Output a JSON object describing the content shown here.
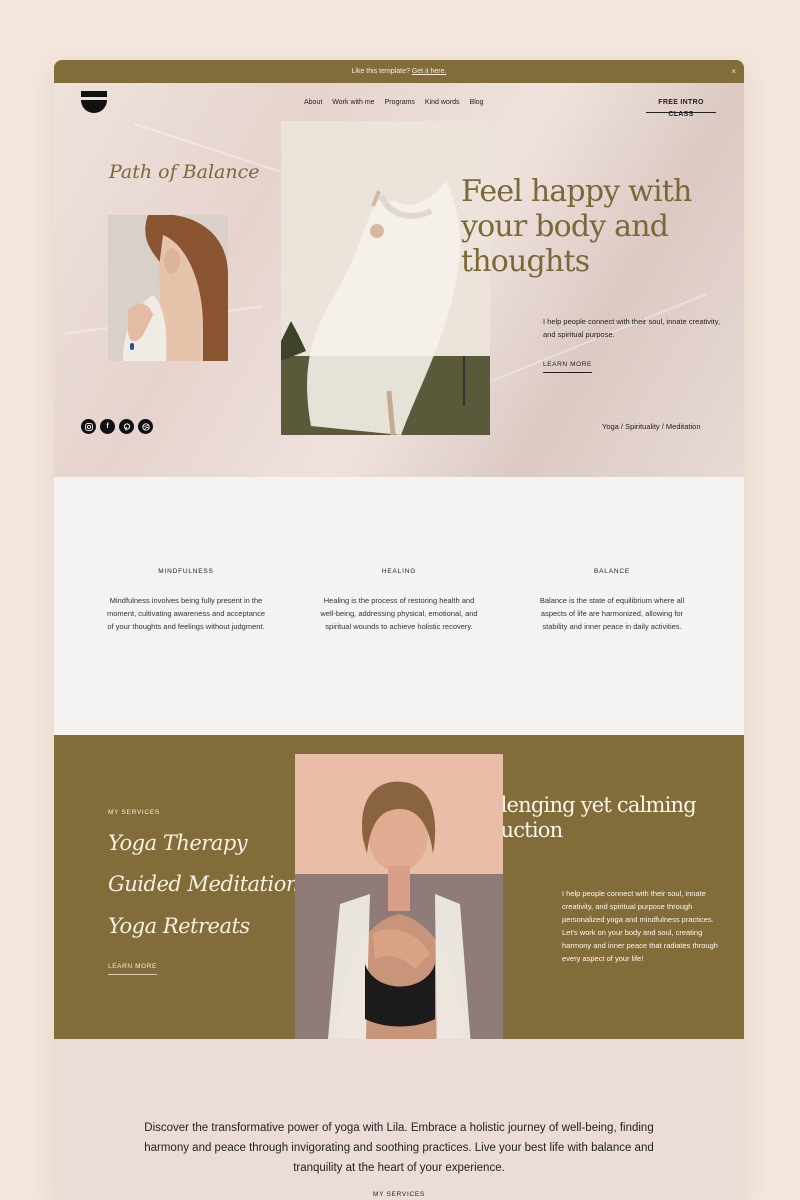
{
  "banner": {
    "text": "Like this template?",
    "link": "Get it here.",
    "close": "×"
  },
  "nav": {
    "items": [
      "About",
      "Work with me",
      "Programs",
      "Kind words",
      "Blog"
    ],
    "cta": "FREE INTRO CLASS"
  },
  "hero": {
    "brand": "Path of Balance",
    "headline": "Feel happy with your body and thoughts",
    "body": "I help people connect with their soul, innate creativity, and spiritual purpose.",
    "learn_more": "LEARN MORE",
    "tagline": "Yoga / Spirituality / Meditation",
    "socials": [
      "instagram-icon",
      "facebook-icon",
      "pinterest-icon",
      "dribbble-icon"
    ]
  },
  "pillars": [
    {
      "title": "MINDFULNESS",
      "text": "Mindfulness involves being fully present in the moment, cultivating awareness and acceptance of your thoughts and feelings without judgment."
    },
    {
      "title": "HEALING",
      "text": "Healing is the process of restoring health and well-being, addressing physical, emotional, and spiritual wounds to achieve holistic recovery."
    },
    {
      "title": "BALANCE",
      "text": "Balance is the state of equilibrium where all aspects of life are harmonized, allowing for stability and inner peace in daily activities."
    }
  ],
  "services": {
    "label": "MY SERVICES",
    "items": [
      "Yoga Therapy",
      "Guided Meditation",
      "Yoga Retreats"
    ],
    "learn_more": "LEARN MORE",
    "title": "Challenging yet calming instruction",
    "body": "I help people connect with their soul, innate creativity, and spiritual purpose through personalized yoga and mindfulness practices. Let's work on your body and soul, creating harmony and inner peace that radiates through every aspect of your life!"
  },
  "bottom": {
    "text": "Discover the transformative power of yoga with Lila. Embrace a holistic journey of well-being, finding harmony and peace through invigorating and soothing practices. Live your best life with balance and tranquility at the heart of your experience.",
    "label": "MY SERVICES"
  },
  "colors": {
    "accent": "#826c3a",
    "page_bg": "#f3e6dc",
    "hero_bg": "#e8d8d3",
    "section_bg": "#f5f3f1",
    "bottom_bg": "#ebdcd8"
  }
}
